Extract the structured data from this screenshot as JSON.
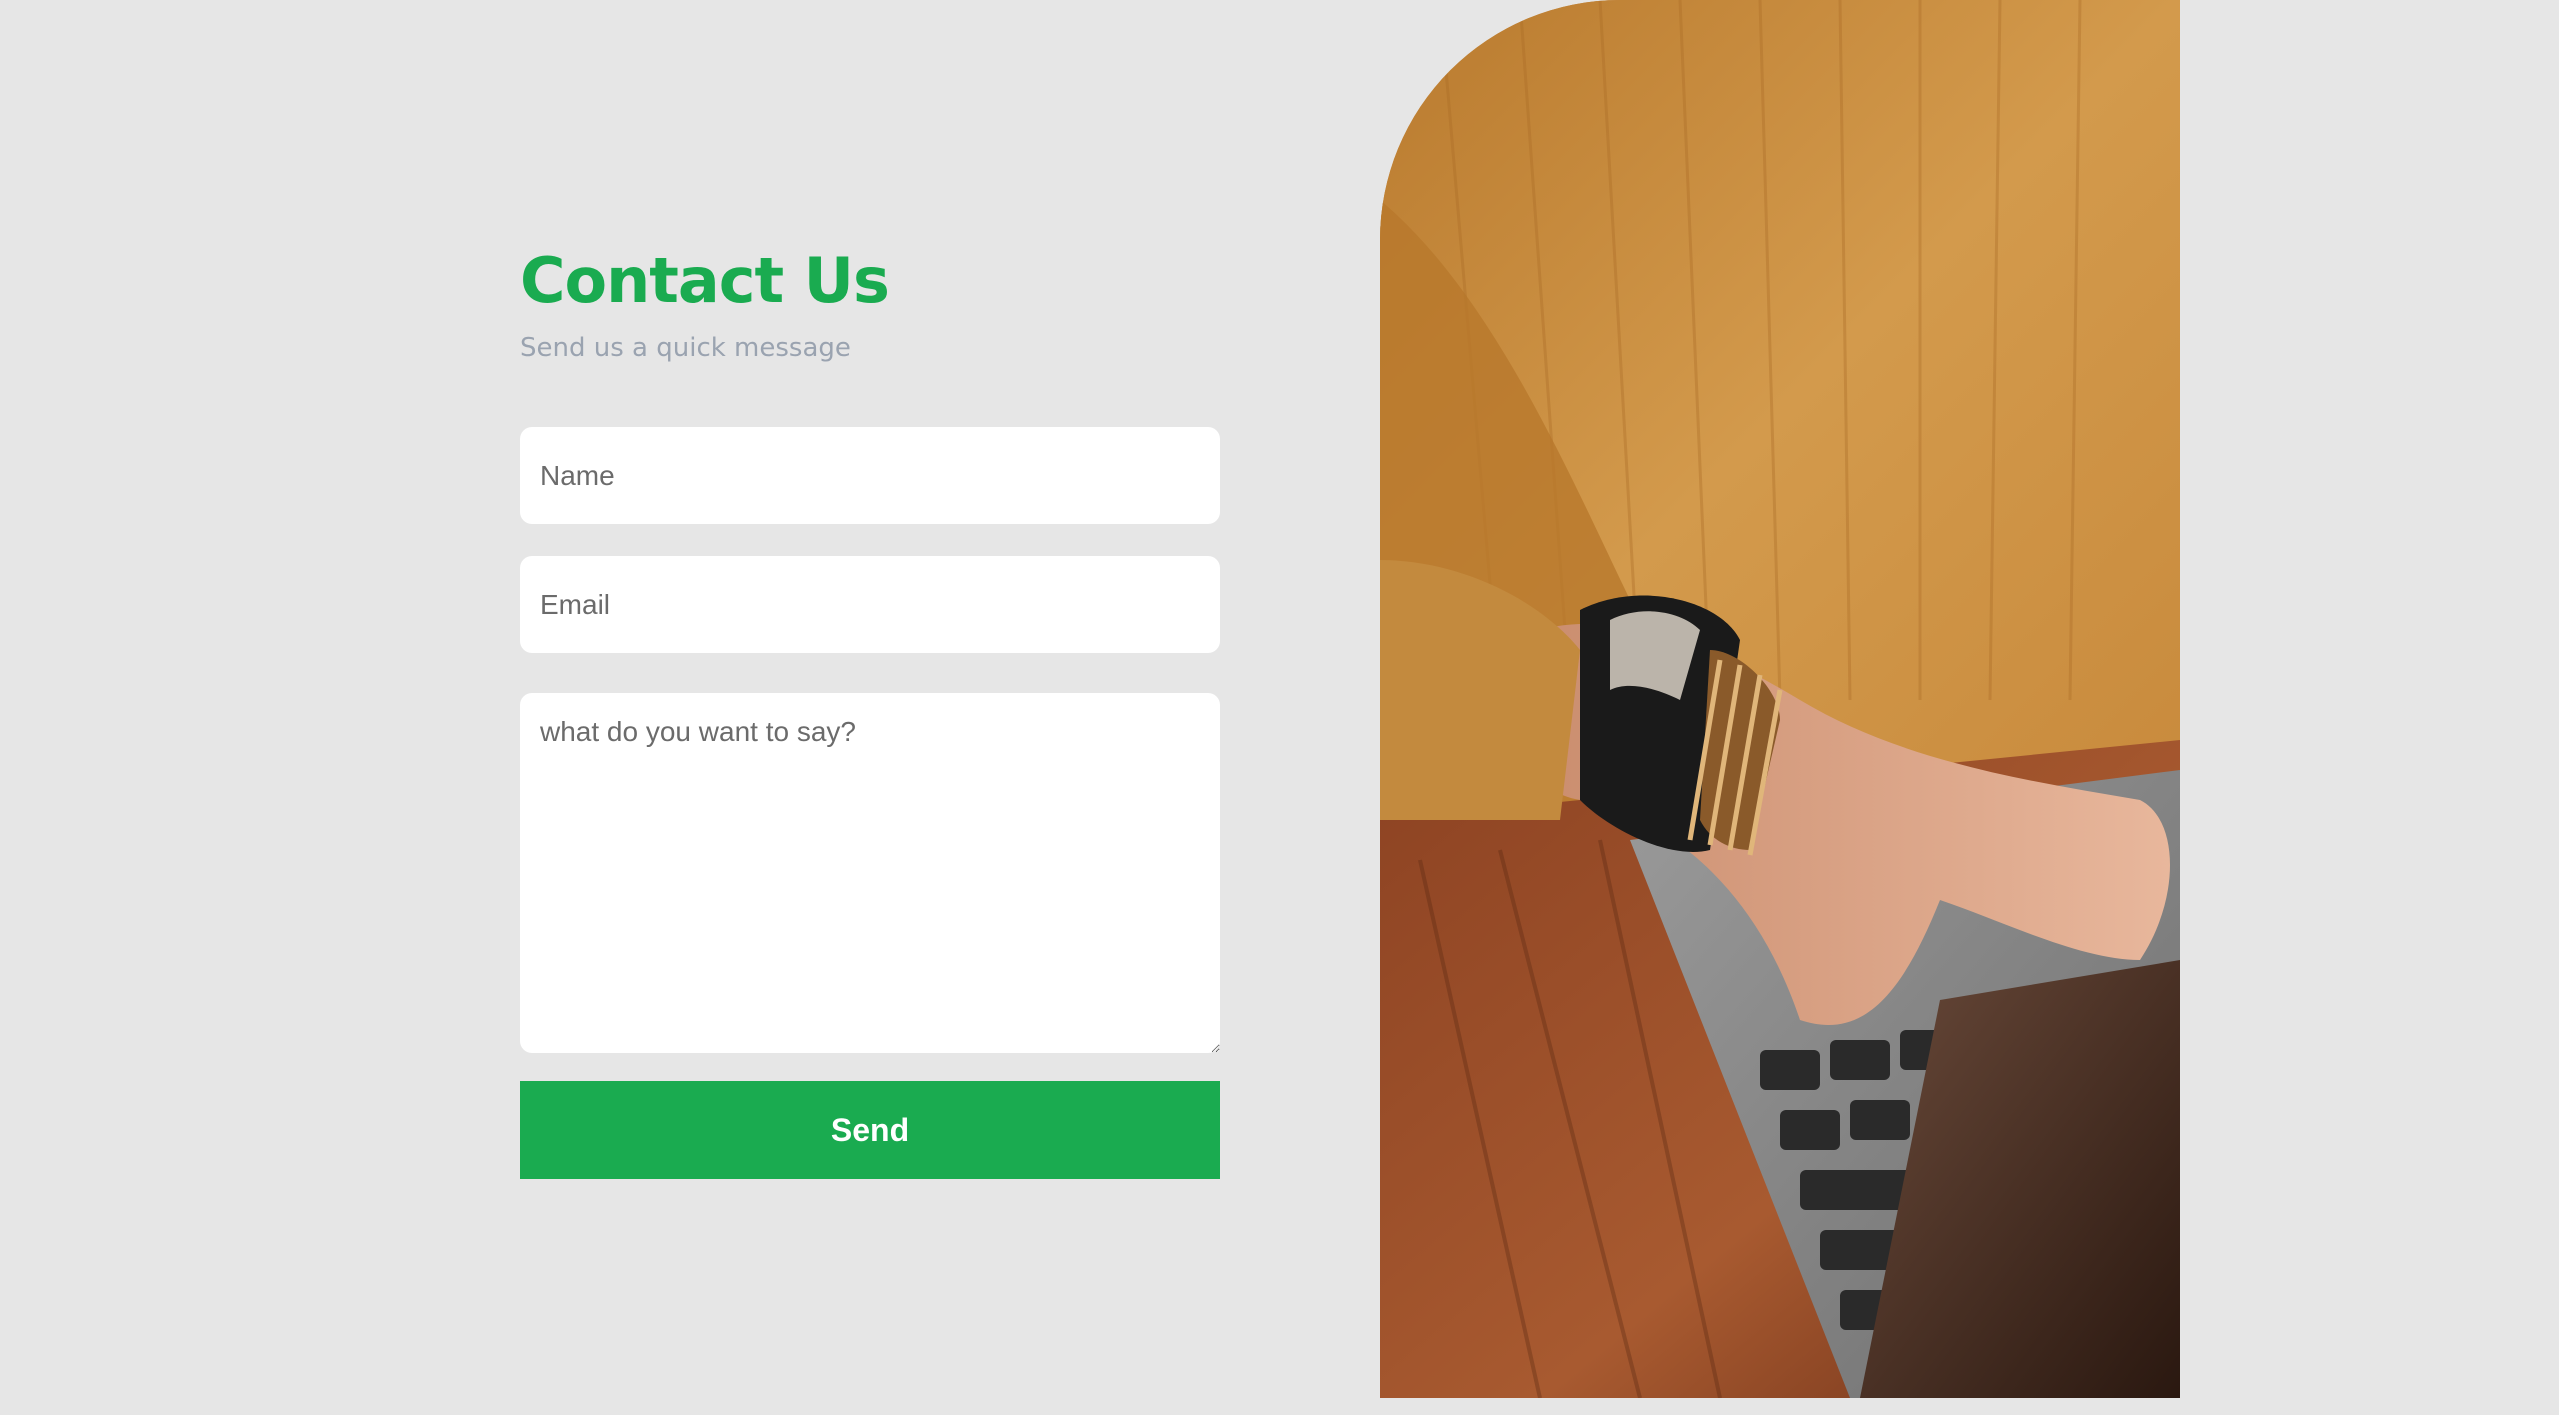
{
  "contact": {
    "title": "Contact Us",
    "subtitle": "Send us a quick message"
  },
  "form": {
    "name_placeholder": "Name",
    "email_placeholder": "Email",
    "message_placeholder": "what do you want to say?",
    "send_label": "Send"
  },
  "colors": {
    "accent": "#1aab50",
    "background": "#e6e6e6",
    "subtitle": "#9aa3b0"
  },
  "image": {
    "subject": "person in mustard sweater with bracelets typing on laptop at wooden desk"
  }
}
